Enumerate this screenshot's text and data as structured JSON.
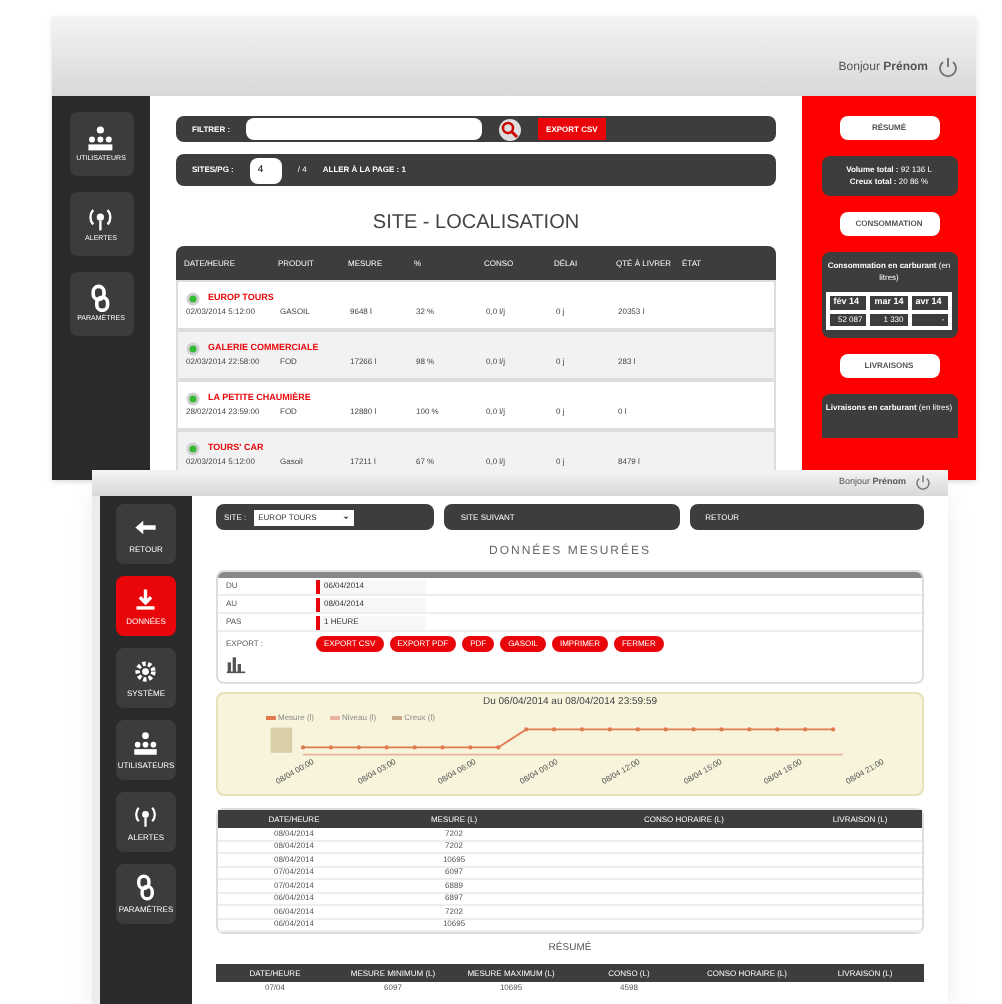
{
  "back_window": {
    "greeting": "Bonjour",
    "user": "Prénom",
    "sidebar": [
      {
        "label": "UTILISATEURS",
        "kind": "users"
      },
      {
        "label": "ALERTES",
        "kind": "alert"
      },
      {
        "label": "PARAMÈTRES",
        "kind": "link"
      }
    ],
    "filter": {
      "label": "FILTRER :",
      "export": "EXPORT CSV"
    },
    "paging": {
      "label": "SITES/PG :",
      "value": "4",
      "total": "/ 4",
      "goto": "ALLER À LA PAGE : 1"
    },
    "title": "SITE - LOCALISATION",
    "table": {
      "columns": [
        "DATE/HEURE",
        "PRODUIT",
        "MESURE",
        "%",
        "CONSO",
        "DÉLAI",
        "QTÉ À LIVRER",
        "ÉTAT"
      ],
      "rows": [
        {
          "site": "EUROP TOURS",
          "cells": [
            "02/03/2014 5:12:00",
            "GASOIL",
            "9648 l",
            "32 %",
            "0,0 l/j",
            "0 j",
            "20353 l"
          ]
        },
        {
          "site": "GALERIE COMMERCIALE",
          "cells": [
            "02/03/2014 22:58:00",
            "FOD",
            "17266 l",
            "98 %",
            "0,0 l/j",
            "0 j",
            "283 l"
          ]
        },
        {
          "site": "LA PETITE CHAUMIÈRE",
          "cells": [
            "28/02/2014 23:59:00",
            "FOD",
            "12880 l",
            "100 %",
            "0,0 l/j",
            "0 j",
            "0 l"
          ]
        },
        {
          "site": "TOURS' CAR",
          "cells": [
            "02/03/2014 5:12:00",
            "Gasoil",
            "17211 l",
            "67 %",
            "0,0 l/j",
            "0 j",
            "8479 l"
          ]
        }
      ]
    },
    "panel": {
      "summary_title": "RÉSUMÉ",
      "volume_label": "Volume total :",
      "volume": "92 136 L",
      "creux_label": "Creux total :",
      "creux": "20 86 %",
      "conso_title": "CONSOMMATION",
      "conso_text": "Consommation en carburant",
      "conso_unit": "(en litres)",
      "conso_table": {
        "columns": [
          "fév 14",
          "mar 14",
          "avr 14"
        ],
        "values": [
          "52 087",
          "1 330",
          "-"
        ]
      },
      "deliv_title": "LIVRAISONS",
      "deliv_text": "Livraisons en carburant",
      "deliv_unit": "(en litres)"
    }
  },
  "front_window": {
    "greeting": "Bonjour",
    "user": "Prénom",
    "sidebar": [
      {
        "label": "RETOUR",
        "kind": "back",
        "selected": false
      },
      {
        "label": "DONNÉES",
        "kind": "data",
        "selected": true
      },
      {
        "label": "SYSTÈME",
        "kind": "gear",
        "selected": false
      },
      {
        "label": "UTILISATEURS",
        "kind": "users",
        "selected": false
      },
      {
        "label": "ALERTES",
        "kind": "alert",
        "selected": false
      },
      {
        "label": "PARAMÈTRES",
        "kind": "link",
        "selected": false
      }
    ],
    "site_label": "SITE :",
    "site_value": "EUROP TOURS",
    "next": "SITE SUIVANT",
    "prev": "RETOUR",
    "title": "DONNÉES MESURÉES",
    "form": [
      {
        "label": "DU",
        "value": "06/04/2014"
      },
      {
        "label": "AU",
        "value": "08/04/2014"
      },
      {
        "label": "PAS",
        "value": "1 HEURE"
      }
    ],
    "actions_label": "EXPORT :",
    "actions": [
      "EXPORT CSV",
      "EXPORT PDF",
      "PDF",
      "GASOIL",
      "IMPRIMER",
      "FERMER"
    ],
    "chart": {
      "title": "Du 06/04/2014 au 08/04/2014 23:59:59",
      "legend": [
        {
          "name": "Mesure (l)",
          "color": "#e07b4f"
        },
        {
          "name": "Niveau (l)",
          "color": "#e8b3a0"
        },
        {
          "name": "Creux (l)",
          "color": "#c9a98a"
        }
      ],
      "x_labels": [
        "08/04 00:00",
        "08/04 03:00",
        "08/04 06:00",
        "08/04 09:00",
        "08/04 12:00",
        "08/04 15:00",
        "08/04 18:00",
        "08/04 21:00"
      ]
    },
    "data_table": {
      "columns": [
        "DATE/HEURE",
        "MESURE (L)",
        "CONSO HORAIRE (L)",
        "LIVRAISON (L)"
      ],
      "rows": [
        [
          "08/04/2014",
          "7202"
        ],
        [
          "08/04/2014",
          "7202"
        ],
        [
          "08/04/2014",
          "10695"
        ],
        [
          "07/04/2014",
          "6097"
        ],
        [
          "07/04/2014",
          "6889"
        ],
        [
          "06/04/2014",
          "6897"
        ],
        [
          "06/04/2014",
          "7202"
        ],
        [
          "06/04/2014",
          "10695"
        ]
      ]
    },
    "summary_title": "RÉSUMÉ",
    "summary_table": {
      "columns": [
        "DATE/HEURE",
        "MESURE MINIMUM (L)",
        "MESURE MAXIMUM (L)",
        "CONSO (L)",
        "CONSO HORAIRE (L)",
        "LIVRAISON (L)"
      ],
      "rows": [
        [
          "07/04",
          "6097",
          "10695",
          "4598"
        ]
      ]
    }
  }
}
